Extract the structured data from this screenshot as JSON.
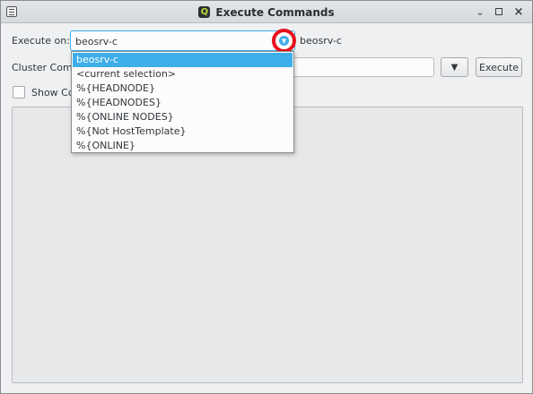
{
  "window": {
    "title": "Execute Commands",
    "logo_letter": "Q"
  },
  "execute_on": {
    "label": "Execute on:",
    "selected": "beosrv-c",
    "host_label": "beosrv-c",
    "options": [
      "beosrv-c",
      "<current selection>",
      "%{HEADNODE}",
      "%{HEADNODES}",
      "%{ONLINE NODES}",
      "%{Not HostTemplate}",
      "%{ONLINE}"
    ]
  },
  "cluster_command": {
    "label": "Cluster Comm",
    "value": ""
  },
  "execute_button": "Execute",
  "show_checkbox": {
    "label": "Show Co",
    "checked": false
  },
  "colors": {
    "accent": "#3daee9",
    "highlight_ring": "#e8101c",
    "background": "#eff0f1"
  },
  "icons": {
    "window_menu": "menu-icon",
    "minimize": "minimize-icon",
    "maximize": "maximize-icon",
    "close": "close-icon",
    "combo_arrow": "chevron-down-icon",
    "history": "chevron-down-icon"
  }
}
